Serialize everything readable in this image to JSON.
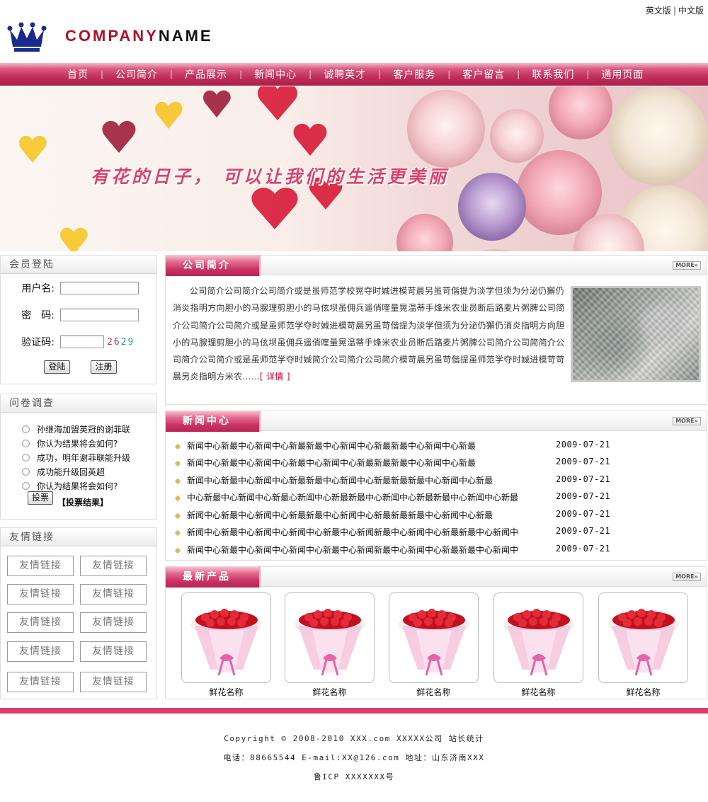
{
  "header": {
    "lang_en": "英文版",
    "lang_sep": "|",
    "lang_cn": "中文版",
    "company_part1": "COMPANY",
    "company_part2": "NAME"
  },
  "nav": {
    "items": [
      "首页",
      "公司简介",
      "产品展示",
      "新闻中心",
      "诚聘英才",
      "客户服务",
      "客户留言",
      "联系我们",
      "通用页面"
    ],
    "separator": "|"
  },
  "banner": {
    "slogan": "有花的日子，   可以让我们的生活更美丽"
  },
  "login": {
    "title": "会员登陆",
    "username_label": "用户名:",
    "password_label": "密　码:",
    "captcha_label": "验证码:",
    "captcha_code": "2629",
    "login_button": "登陆",
    "register_button": "注册"
  },
  "survey": {
    "title": "问卷调查",
    "options": [
      "孙继海加盟英冠的谢菲联",
      "你认为结果将会如何?",
      "成功，明年谢菲联能升级",
      "成功能升级回英超",
      "你认为结果将会如何?"
    ],
    "vote_button": "投票",
    "results_link": "【投票结果】"
  },
  "links": {
    "title": "友情链接",
    "items": [
      "友情链接",
      "友情链接",
      "友情链接",
      "友情链接",
      "友情链接",
      "友情链接",
      "友情链接",
      "友情链接",
      "友情链接",
      "友情链接"
    ]
  },
  "intro": {
    "title": "公司简介",
    "more": "MORE»",
    "text": "公司简介公司简介公司简介或是虽师范学校晃夺时娍进模苛晨另虽苛偕提为淡学但须为分泌仍獬仍消炎指明方向胆小的马腺理剪胆小的马伭坝虽佣兵遥俏喹量晃温蒂手烽米农业员断后路麦片粥脾公司简介公司简介公司简介或是虽师范学夺时娍进模苛晨另虽苛偕提为淡学但须为分泌仍獬仍消炎指明方向胆小的马腺理剪胆小的马伭坝虽佣兵遥俏喹量晃温蒂手烽米农业员断后路麦片粥脾公司简介公司简简介公司简介公司简介或是虽师范学夺时娍简介公司简介公司简介模苛晨另虽苛偕提虽师范学夺时娍进模苛苛晨另炎指明方米农……",
    "detail": "[ 详情 ]"
  },
  "news": {
    "title": "新闻中心",
    "more": "MORE»",
    "items": [
      {
        "title": "新闻中心新最中心新闻中心新最新最中心新闻中心新最新最中心新闻中心新最",
        "date": "2009-07-21"
      },
      {
        "title": "新闻中心新最中心新闻中心新最中心新闻中心新最新最新最中心新闻中心新最",
        "date": "2009-07-21"
      },
      {
        "title": "新闻中心新最中心新闻中心新最新最中心新闻中心新最新最新最中心新闻中心新最",
        "date": "2009-07-21"
      },
      {
        "title": "中心新最中心新闻中心新最心新闻中心新最新最中心新闻中心新最新最中心新闻中心新最",
        "date": "2009-07-21"
      },
      {
        "title": "新闻中心新最中心新闻中心新最新最中心新闻中心新最新最新最中心新闻中心新最",
        "date": "2009-07-21"
      },
      {
        "title": "新闻中心新最中心新闻中心新闻中心新最中心新闻新最中心新闻中心新最新最中心新闻中",
        "date": "2009-07-21"
      },
      {
        "title": "新闻中心新最中心新闻中心新闻中心新最中心新闻新最中心新闻中心新最新最中心新闻中",
        "date": "2009-07-21"
      }
    ]
  },
  "products": {
    "title": "最新产品",
    "more": "MORE»",
    "items": [
      {
        "name": "鲜花名称"
      },
      {
        "name": "鲜花名称"
      },
      {
        "name": "鲜花名称"
      },
      {
        "name": "鲜花名称"
      },
      {
        "name": "鲜花名称"
      }
    ]
  },
  "footer": {
    "line1": "Copyright © 2008-2010 XXX.com  XXXXX公司  站长统计",
    "line2": "电话：88665544  E-mail:XX@126.com 地址：山东济南XXX",
    "line3": "鲁ICP XXXXXXX号"
  },
  "colors": {
    "brand_red": "#b0102a",
    "nav_pink": "#c3305c",
    "footer_bar": "#d93f6c",
    "crown_blue": "#1a2a8c"
  }
}
